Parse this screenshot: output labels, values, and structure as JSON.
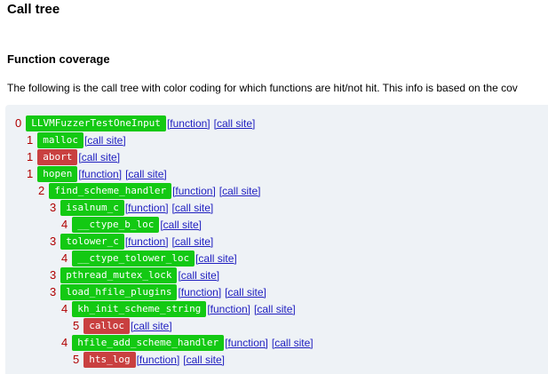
{
  "page": {
    "title": "Call tree",
    "subtitle": "Function coverage",
    "description": "The following is the call tree with color coding for which functions are hit/not hit. This info is based on the cov"
  },
  "colors": {
    "hit": "#13c913",
    "miss": "#c94040",
    "depth": "#b00000",
    "link": "#2020c0",
    "panel": "#eef2f6"
  },
  "tree": [
    {
      "depth": "0",
      "name": "LLVMFuzzerTestOneInput",
      "status": "hit",
      "links": [
        "[function]",
        "[call site]"
      ]
    },
    {
      "depth": "1",
      "name": "malloc",
      "status": "hit",
      "links": [
        "[call site]"
      ]
    },
    {
      "depth": "1",
      "name": "abort",
      "status": "miss",
      "links": [
        "[call site]"
      ]
    },
    {
      "depth": "1",
      "name": "hopen",
      "status": "hit",
      "links": [
        "[function]",
        "[call site]"
      ]
    },
    {
      "depth": "2",
      "name": "find_scheme_handler",
      "status": "hit",
      "links": [
        "[function]",
        "[call site]"
      ]
    },
    {
      "depth": "3",
      "name": "isalnum_c",
      "status": "hit",
      "links": [
        "[function]",
        "[call site]"
      ]
    },
    {
      "depth": "4",
      "name": "__ctype_b_loc",
      "status": "hit",
      "links": [
        "[call site]"
      ]
    },
    {
      "depth": "3",
      "name": "tolower_c",
      "status": "hit",
      "links": [
        "[function]",
        "[call site]"
      ]
    },
    {
      "depth": "4",
      "name": "__ctype_tolower_loc",
      "status": "hit",
      "links": [
        "[call site]"
      ]
    },
    {
      "depth": "3",
      "name": "pthread_mutex_lock",
      "status": "hit",
      "links": [
        "[call site]"
      ]
    },
    {
      "depth": "3",
      "name": "load_hfile_plugins",
      "status": "hit",
      "links": [
        "[function]",
        "[call site]"
      ]
    },
    {
      "depth": "4",
      "name": "kh_init_scheme_string",
      "status": "hit",
      "links": [
        "[function]",
        "[call site]"
      ]
    },
    {
      "depth": "5",
      "name": "calloc",
      "status": "miss",
      "links": [
        "[call site]"
      ]
    },
    {
      "depth": "4",
      "name": "hfile_add_scheme_handler",
      "status": "hit",
      "links": [
        "[function]",
        "[call site]"
      ]
    },
    {
      "depth": "5",
      "name": "hts_log",
      "status": "miss",
      "links": [
        "[function]",
        "[call site]"
      ]
    }
  ]
}
